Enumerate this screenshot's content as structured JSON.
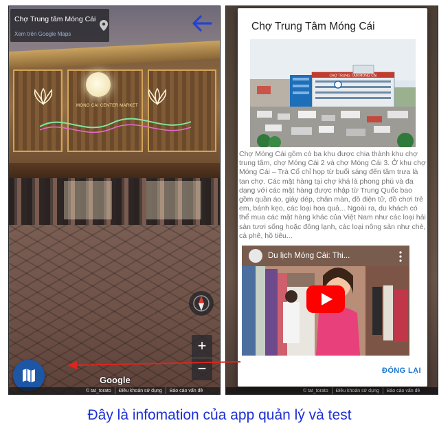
{
  "street_view": {
    "place_title": "Chợ Trung tâm Móng Cái",
    "maps_link": "Xem trên Google Maps",
    "building_sign": "MONG CAI CENTER MARKET",
    "google_logo": "Google",
    "zoom_in_label": "+",
    "zoom_out_label": "−",
    "footer": {
      "credit": "© tat_torato",
      "terms": "Điều khoản sử dụng",
      "report": "Báo cáo vấn đề"
    },
    "icons": {
      "back": "arrow-left-icon",
      "pin": "map-pin-icon",
      "compass": "compass-icon",
      "map": "map-icon"
    },
    "accent_color": "#2442d6",
    "map_button_color": "#1e56a6"
  },
  "info_dialog": {
    "title": "Chợ Trung Tâm Móng Cái",
    "photo_sign": "CHỢ TRUNG TÂM MÓNG CÁI",
    "description": "Chợ Móng Cái gồm có ba khu được chia thành khu chợ trung tâm, chợ Móng Cái 2 và chợ Móng Cái 3. Ở khu chợ Móng Cái – Trà Cổ chỉ họp từ buổi sáng đến tầm trưa là tan chợ. Các mặt hàng tại chợ khá là phong phú và đa dạng với các mặt hàng được nhập từ Trung Quốc bao gồm quần áo, giày dép, chăn màn, đồ điện tử, đồ chơi trẻ em, bánh kẹo, các loại hoa quả... Ngoài ra, du khách có thể mua các mặt hàng khác của Việt Nam như các loại hải sản tươi sống hoặc đông lạnh, các loại nông sản như chè, cà phê, hồ tiêu...",
    "video_title": "Du lịch Móng Cái: Thi...",
    "close_label": "ĐÓNG LẠI",
    "close_color": "#1976d2",
    "icons": {
      "play": "youtube-play-icon",
      "more": "more-vert-icon"
    },
    "background_footer": {
      "credit": "© tat_torato",
      "terms": "Điều khoản sử dụng",
      "report": "Báo cáo vấn đề"
    }
  },
  "caption": "Đây là infomation của app quản lý và test",
  "caption_color": "#1b2fd6",
  "arrow_color": "#e0241c"
}
